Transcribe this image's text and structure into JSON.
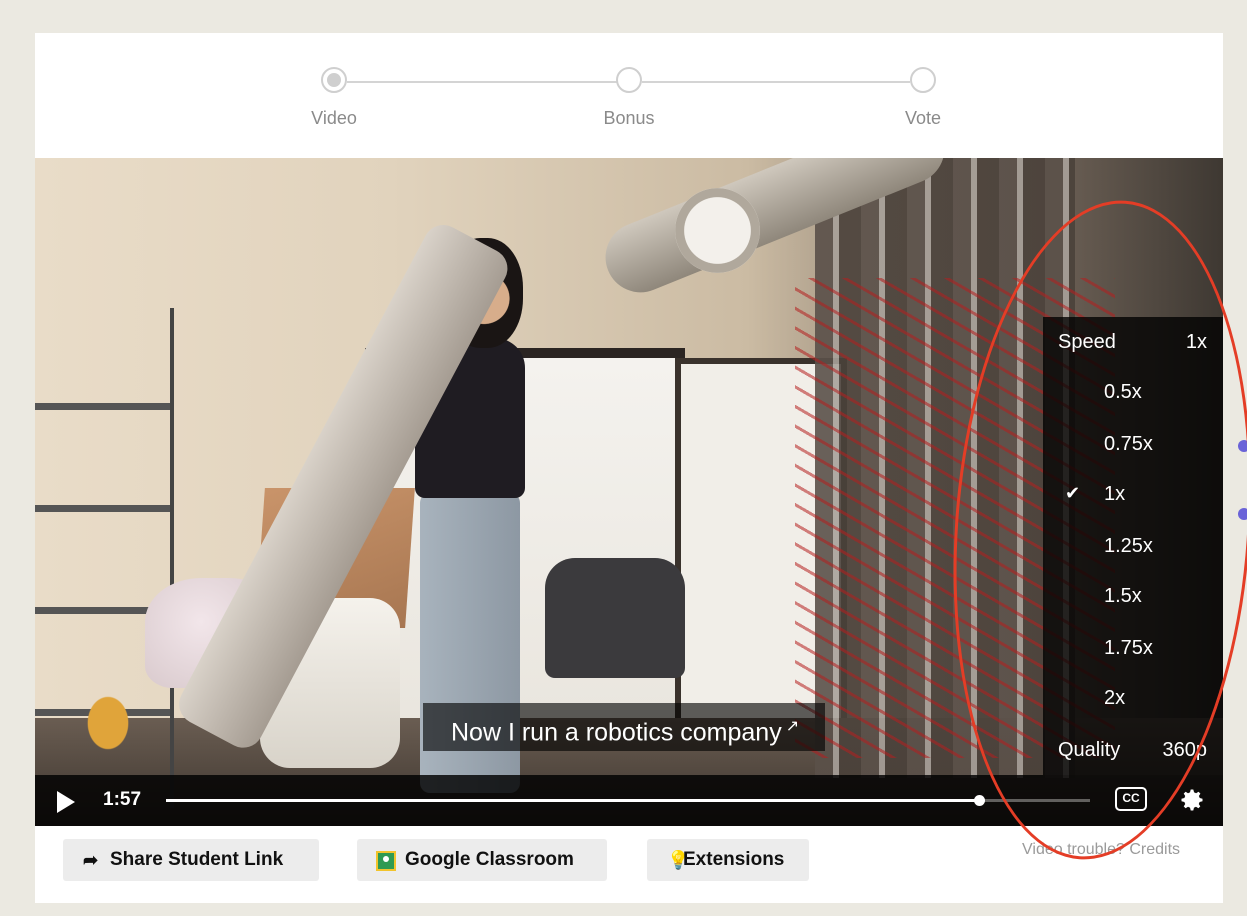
{
  "stepper": {
    "steps": [
      {
        "label": "Video",
        "active": true
      },
      {
        "label": "Bonus",
        "active": false
      },
      {
        "label": "Vote",
        "active": false
      }
    ]
  },
  "video": {
    "caption": "Now I run a robotics company",
    "caption_icon": "external-link-icon",
    "time": "1:57",
    "progress_fraction": 0.88,
    "cc_label": "CC"
  },
  "settings_menu": {
    "speed_label": "Speed",
    "speed_value": "1x",
    "options": [
      "0.5x",
      "0.75x",
      "1x",
      "1.25x",
      "1.5x",
      "1.75x",
      "2x"
    ],
    "selected": "1x",
    "quality_label": "Quality",
    "quality_value": "360p"
  },
  "actions": {
    "share_label": "Share Student Link",
    "classroom_label": "Google Classroom",
    "extensions_label": "Extensions",
    "trouble_text": "Video trouble? Credits"
  },
  "colors": {
    "annotation": "#e43d26",
    "page_bg": "#ebe9e1"
  }
}
